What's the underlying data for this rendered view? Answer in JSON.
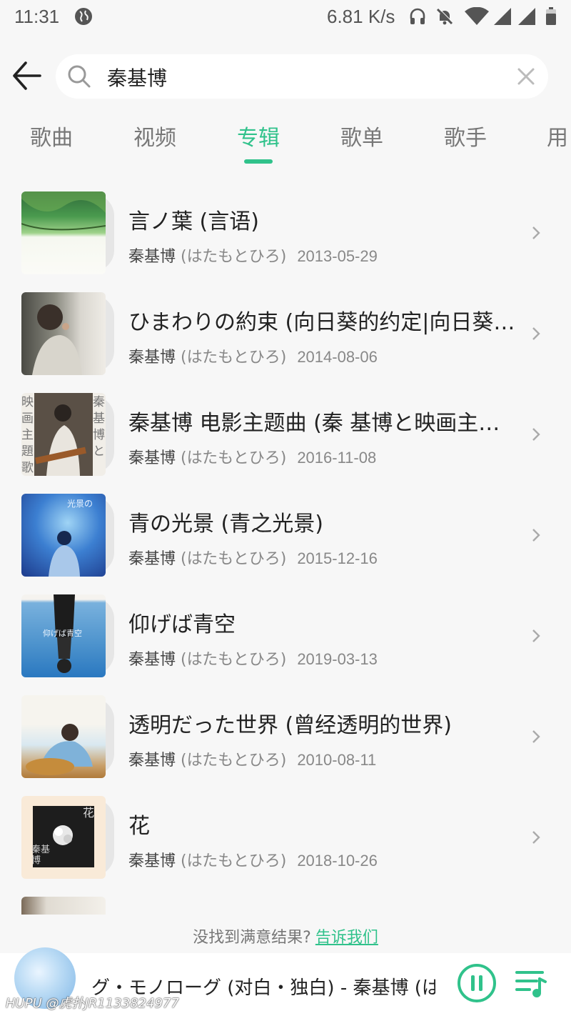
{
  "status_bar": {
    "time": "11:31",
    "speed": "6.81 K/s"
  },
  "search": {
    "query": "秦基博"
  },
  "tabs": [
    {
      "label": "歌曲",
      "active": false
    },
    {
      "label": "视频",
      "active": false
    },
    {
      "label": "专辑",
      "active": true
    },
    {
      "label": "歌单",
      "active": false
    },
    {
      "label": "歌手",
      "active": false
    },
    {
      "label": "用",
      "active": false
    }
  ],
  "albums": [
    {
      "title": "言ノ葉 (言语)",
      "artist": "秦基博",
      "romaji": "(はたもとひろ)",
      "date": "2013-05-29"
    },
    {
      "title": "ひまわりの約束 (向日葵的约定|向日葵…",
      "artist": "秦基博",
      "romaji": "(はたもとひろ)",
      "date": "2014-08-06"
    },
    {
      "title": "秦基博 电影主题曲 (秦 基博と映画主…",
      "artist": "秦基博",
      "romaji": "(はたもとひろ)",
      "date": "2016-11-08",
      "cover_text_left": "映画主題歌",
      "cover_text_right": "秦基博と"
    },
    {
      "title": "青の光景 (青之光景)",
      "artist": "秦基博",
      "romaji": "(はたもとひろ)",
      "date": "2015-12-16",
      "cover_text": "光景の"
    },
    {
      "title": "仰げば青空",
      "artist": "秦基博",
      "romaji": "(はたもとひろ)",
      "date": "2019-03-13",
      "cover_text": "仰げば青空"
    },
    {
      "title": "透明だった世界 (曾经透明的世界)",
      "artist": "秦基博",
      "romaji": "(はたもとひろ)",
      "date": "2010-08-11"
    },
    {
      "title": "花",
      "artist": "秦基博",
      "romaji": "(はたもとひろ)",
      "date": "2018-10-26",
      "cover_text_top": "花",
      "cover_text_bottom": "秦基博"
    },
    {
      "title": "",
      "artist": "",
      "romaji": "",
      "date": ""
    }
  ],
  "feedback": {
    "text": "没找到满意结果?",
    "link": "告诉我们"
  },
  "player": {
    "now_playing": "グ・モノローグ (对白・独白) - 秦基博 (はた",
    "watermark": "HUPU @虎扑JR1133824977"
  },
  "colors": {
    "accent": "#30c28b",
    "background": "#f7f7f7"
  }
}
